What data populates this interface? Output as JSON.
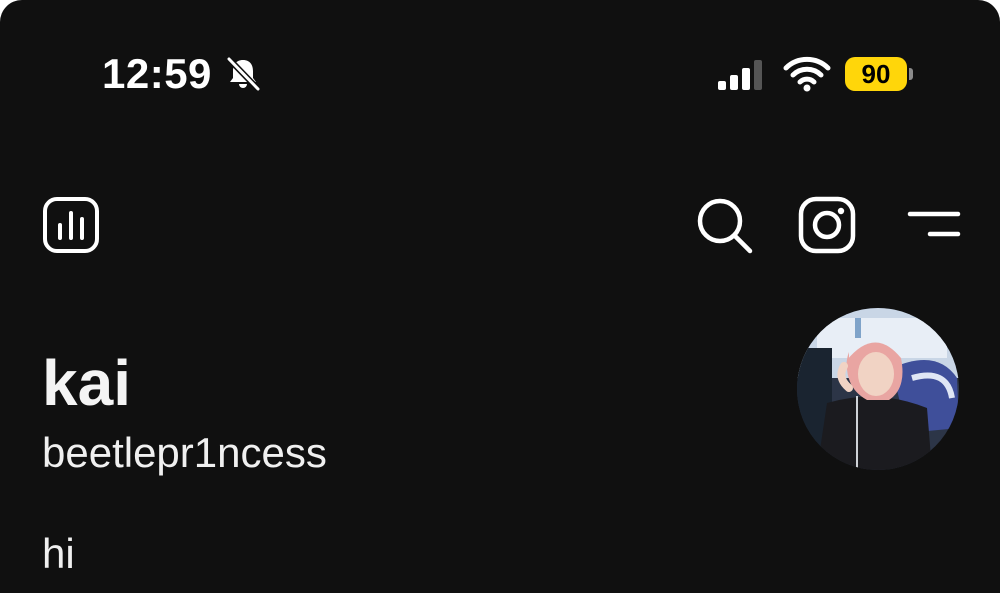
{
  "status_bar": {
    "time": "12:59",
    "battery_level": "90",
    "silent_mode": true,
    "battery_color": "#ffd60a"
  },
  "nav": {
    "left_icon": "insights-icon",
    "right_icons": [
      "search-icon",
      "instagram-icon",
      "menu-icon"
    ]
  },
  "profile": {
    "display_name": "kai",
    "username": "beetlepr1ncess",
    "bio": "hi"
  },
  "theme": {
    "background": "#101010",
    "text": "#f4f4f4"
  }
}
